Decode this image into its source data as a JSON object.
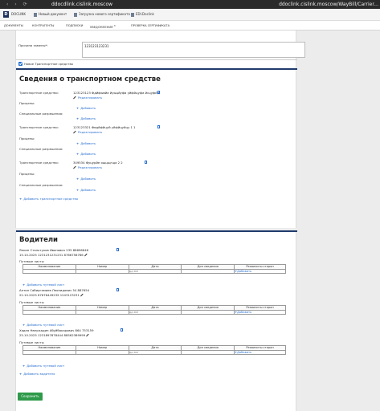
{
  "browser": {
    "nav_glyphs": "‹ › ⟳",
    "url_left": "ddocdlink.cislink.moscow",
    "url_right": "ddoclink.cislink.moscow/WayBill/Carrier..."
  },
  "bookmarks": {
    "logo": "D",
    "items": [
      "DOCLINK",
      "Новый документ",
      "Загрузка нового сертификата",
      "EDI.Doclink"
    ]
  },
  "app_nav": {
    "items": [
      "ДОКУМЕНТЫ",
      "КОНТРАГЕНТЫ",
      "ПОДПИСКИ",
      "УВЕДОМЛЕНИЯ",
      "ПРОВЕРКА СЕРТИФИКАТА"
    ],
    "badge": "3"
  },
  "form": {
    "field_label": "Причина замены*:",
    "field_value": "123123123231",
    "new_transport_checkbox": "Новое Транспортное средство"
  },
  "transport_section": {
    "title": "Сведения о транспортном средстве",
    "vehicles": [
      {
        "label": "Транспортное средство:",
        "value": "123123123 Фдйфывйа йуыцйуфа уйфйцуфа йсцуфйд",
        "edit": "Редактировать",
        "trailers_label": "Прицепы:",
        "add": "Добавить",
        "permits_label": "Специальные разрешения:",
        "permits_add": "Добавить"
      },
      {
        "label": "Транспортное средство:",
        "value": "123123321 Фвдйфйцуй уйфйцуйцу 1 1",
        "edit": "Редактировать",
        "trailers_label": "Прицепы:",
        "add": "Добавить",
        "permits_label": "Специальные разрешения:",
        "permits_add": "Добавить"
      },
      {
        "label": "Транспортное средство:",
        "value": "349534 Фуцурйе ощцщгща 2 2",
        "edit": "Редактировать",
        "trailers_label": "Прицепы:",
        "add": "Добавить",
        "permits_label": "Специальные разрешения:",
        "permits_add": "Добавить"
      }
    ],
    "add_vehicle": "Добавить транспортное средство"
  },
  "drivers_section": {
    "title": "Водители",
    "table_headers": [
      "Наименование",
      "Номер",
      "Дата",
      "Доп сведения",
      "Реквизиты сторон"
    ],
    "waybills_label": "Путевые листы",
    "date_placeholder": "дд.мм",
    "row_add": "Добавить",
    "add_waybill": "Добавить путевой лист",
    "drivers": [
      {
        "line1": "Янкин Стальтуков Иванович 235 88696646",
        "line2": "15.10.2025 1231231231231 8766756766"
      },
      {
        "line1": "Антон Сабиргамиев Леонидович 54 887654",
        "line2": "22.10.2025 67676449239 1243123231"
      },
      {
        "line1": "Хадня Нвеужадин Абуйбакарович 864 753159",
        "line2": "25.10.2025 1231897878444 88562389999"
      }
    ],
    "add_driver": "Добавить водителя"
  },
  "save_button": "Сохранить"
}
